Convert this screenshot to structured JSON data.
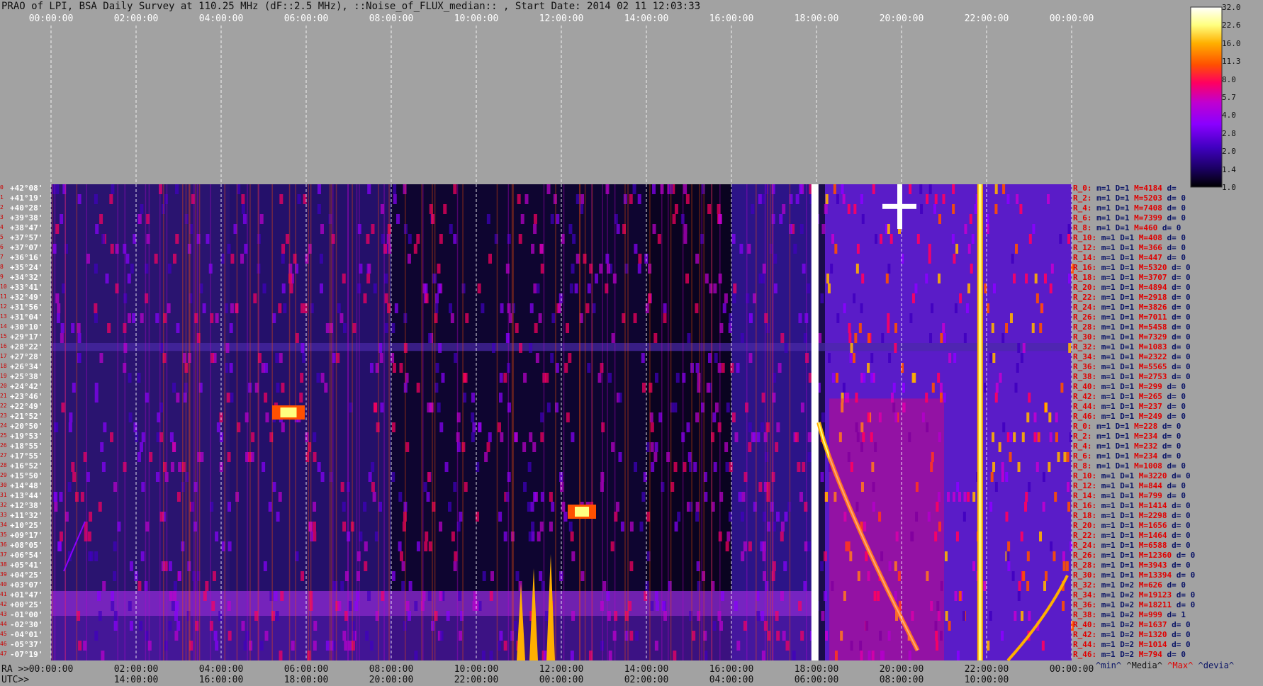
{
  "title": "PRAO of LPI, BSA Daily Survey at 110.25 MHz (dF::2.5 MHz), ::Noise_of_FLUX_median:: , Start Date: 2014 02 11 12:03:33",
  "chart_data": {
    "type": "heatmap",
    "title": "PRAO of LPI, BSA Daily Survey at 110.25 MHz (dF::2.5 MHz), ::Noise_of_FLUX_median:: , Start Date: 2014 02 11 12:03:33",
    "x_top_ticks": [
      "00:00:00",
      "02:00:00",
      "04:00:00",
      "06:00:00",
      "08:00:00",
      "10:00:00",
      "12:00:00",
      "14:00:00",
      "16:00:00",
      "18:00:00",
      "20:00:00",
      "22:00:00",
      "00:00:00"
    ],
    "x_bottom_ra_label": "RA >>",
    "x_bottom_ra_ticks": [
      "00:00:00",
      "02:00:00",
      "04:00:00",
      "06:00:00",
      "08:00:00",
      "10:00:00",
      "12:00:00",
      "14:00:00",
      "16:00:00",
      "18:00:00",
      "20:00:00",
      "22:00:00",
      "00:00:00"
    ],
    "x_bottom_utc_label": "UTC>>",
    "x_bottom_utc_ticks": [
      "14:00:00",
      "16:00:00",
      "18:00:00",
      "20:00:00",
      "22:00:00",
      "00:00:00",
      "02:00:00",
      "04:00:00",
      "06:00:00",
      "08:00:00",
      "10:00:00"
    ],
    "y_declination_labels": [
      "+42°08'",
      "+41°19'",
      "+40°28'",
      "+39°38'",
      "+38°47'",
      "+37°57'",
      "+37°07'",
      "+36°16'",
      "+35°24'",
      "+34°32'",
      "+33°41'",
      "+32°49'",
      "+31°56'",
      "+31°04'",
      "+30°10'",
      "+29°17'",
      "+28°22'",
      "+27°28'",
      "+26°34'",
      "+25°38'",
      "+24°42'",
      "+23°46'",
      "+22°49'",
      "+21°52'",
      "+20°50'",
      "+19°53'",
      "+18°55'",
      "+17°55'",
      "+16°52'",
      "+15°50'",
      "+14°48'",
      "+13°44'",
      "+12°38'",
      "+11°32'",
      "+10°25'",
      "+09°17'",
      "+08°05'",
      "+06°54'",
      "+05°41'",
      "+04°25'",
      "+03°07'",
      "+01°47'",
      "+00°25'",
      "-01°00'",
      "-02°30'",
      "-04°01'",
      "-05°37'",
      "-07°19'"
    ],
    "colorbar": {
      "ticks": [
        "32.0",
        "22.6",
        "16.0",
        "11.3",
        "8.0",
        "5.7",
        "4.0",
        "2.8",
        "2.0",
        "1.4",
        "1.0"
      ],
      "scale": "log",
      "range": [
        1.0,
        32.0
      ],
      "colormap": [
        "#000000",
        "#1a0060",
        "#4000c0",
        "#8a00ff",
        "#c000d0",
        "#ff0060",
        "#ff5000",
        "#ffb000",
        "#ffff80",
        "#ffffff"
      ]
    },
    "row_stats": [
      {
        "r": "R_0:",
        "m": "m=1",
        "d": "D=1",
        "max": "M=4184",
        "dev": "d="
      },
      {
        "r": "R_2:",
        "m": "m=1",
        "d": "D=1",
        "max": "M=5203",
        "dev": "d= 0"
      },
      {
        "r": "R_4:",
        "m": "m=1",
        "d": "D=1",
        "max": "M=7408",
        "dev": "d= 0"
      },
      {
        "r": "R_6:",
        "m": "m=1",
        "d": "D=1",
        "max": "M=7399",
        "dev": "d= 0"
      },
      {
        "r": "R_8:",
        "m": "m=1",
        "d": "D=1",
        "max": "M=460",
        "dev": "d= 0"
      },
      {
        "r": "R_10:",
        "m": "m=1",
        "d": "D=1",
        "max": "M=408",
        "dev": "d= 0"
      },
      {
        "r": "R_12:",
        "m": "m=1",
        "d": "D=1",
        "max": "M=366",
        "dev": "d= 0"
      },
      {
        "r": "R_14:",
        "m": "m=1",
        "d": "D=1",
        "max": "M=447",
        "dev": "d= 0"
      },
      {
        "r": "R_16:",
        "m": "m=1",
        "d": "D=1",
        "max": "M=5320",
        "dev": "d= 0"
      },
      {
        "r": "R_18:",
        "m": "m=1",
        "d": "D=1",
        "max": "M=3707",
        "dev": "d= 0"
      },
      {
        "r": "R_20:",
        "m": "m=1",
        "d": "D=1",
        "max": "M=4894",
        "dev": "d= 0"
      },
      {
        "r": "R_22:",
        "m": "m=1",
        "d": "D=1",
        "max": "M=2918",
        "dev": "d= 0"
      },
      {
        "r": "R_24:",
        "m": "m=1",
        "d": "D=1",
        "max": "M=3826",
        "dev": "d= 0"
      },
      {
        "r": "R_26:",
        "m": "m=1",
        "d": "D=1",
        "max": "M=7011",
        "dev": "d= 0"
      },
      {
        "r": "R_28:",
        "m": "m=1",
        "d": "D=1",
        "max": "M=5458",
        "dev": "d= 0"
      },
      {
        "r": "R_30:",
        "m": "m=1",
        "d": "D=1",
        "max": "M=7329",
        "dev": "d= 0"
      },
      {
        "r": "R_32:",
        "m": "m=1",
        "d": "D=1",
        "max": "M=1083",
        "dev": "d= 0"
      },
      {
        "r": "R_34:",
        "m": "m=1",
        "d": "D=1",
        "max": "M=2322",
        "dev": "d= 0"
      },
      {
        "r": "R_36:",
        "m": "m=1",
        "d": "D=1",
        "max": "M=5565",
        "dev": "d= 0"
      },
      {
        "r": "R_38:",
        "m": "m=1",
        "d": "D=1",
        "max": "M=2753",
        "dev": "d= 0"
      },
      {
        "r": "R_40:",
        "m": "m=1",
        "d": "D=1",
        "max": "M=299",
        "dev": "d= 0"
      },
      {
        "r": "R_42:",
        "m": "m=1",
        "d": "D=1",
        "max": "M=265",
        "dev": "d= 0"
      },
      {
        "r": "R_44:",
        "m": "m=1",
        "d": "D=1",
        "max": "M=237",
        "dev": "d= 0"
      },
      {
        "r": "R_46:",
        "m": "m=1",
        "d": "D=1",
        "max": "M=249",
        "dev": "d= 0"
      },
      {
        "r": "R_0:",
        "m": "m=1",
        "d": "D=1",
        "max": "M=228",
        "dev": "d= 0"
      },
      {
        "r": "R_2:",
        "m": "m=1",
        "d": "D=1",
        "max": "M=234",
        "dev": "d= 0"
      },
      {
        "r": "R_4:",
        "m": "m=1",
        "d": "D=1",
        "max": "M=232",
        "dev": "d= 0"
      },
      {
        "r": "R_6:",
        "m": "m=1",
        "d": "D=1",
        "max": "M=234",
        "dev": "d= 0"
      },
      {
        "r": "R_8:",
        "m": "m=1",
        "d": "D=1",
        "max": "M=1008",
        "dev": "d= 0"
      },
      {
        "r": "R_10:",
        "m": "m=1",
        "d": "D=1",
        "max": "M=3220",
        "dev": "d= 0"
      },
      {
        "r": "R_12:",
        "m": "m=1",
        "d": "D=1",
        "max": "M=844",
        "dev": "d= 0"
      },
      {
        "r": "R_14:",
        "m": "m=1",
        "d": "D=1",
        "max": "M=799",
        "dev": "d= 0"
      },
      {
        "r": "R_16:",
        "m": "m=1",
        "d": "D=1",
        "max": "M=1414",
        "dev": "d= 0"
      },
      {
        "r": "R_18:",
        "m": "m=1",
        "d": "D=1",
        "max": "M=2298",
        "dev": "d= 0"
      },
      {
        "r": "R_20:",
        "m": "m=1",
        "d": "D=1",
        "max": "M=1656",
        "dev": "d= 0"
      },
      {
        "r": "R_22:",
        "m": "m=1",
        "d": "D=1",
        "max": "M=1464",
        "dev": "d= 0"
      },
      {
        "r": "R_24:",
        "m": "m=1",
        "d": "D=1",
        "max": "M=6588",
        "dev": "d= 0"
      },
      {
        "r": "R_26:",
        "m": "m=1",
        "d": "D=1",
        "max": "M=12360",
        "dev": "d= 0"
      },
      {
        "r": "R_28:",
        "m": "m=1",
        "d": "D=1",
        "max": "M=3943",
        "dev": "d= 0"
      },
      {
        "r": "R_30:",
        "m": "m=1",
        "d": "D=1",
        "max": "M=13394",
        "dev": "d= 0"
      },
      {
        "r": "R_32:",
        "m": "m=1",
        "d": "D=2",
        "max": "M=626",
        "dev": "d= 0"
      },
      {
        "r": "R_34:",
        "m": "m=1",
        "d": "D=2",
        "max": "M=19123",
        "dev": "d= 0"
      },
      {
        "r": "R_36:",
        "m": "m=1",
        "d": "D=2",
        "max": "M=18211",
        "dev": "d= 0"
      },
      {
        "r": "R_38:",
        "m": "m=1",
        "d": "D=2",
        "max": "M=999",
        "dev": "d= 1"
      },
      {
        "r": "R_40:",
        "m": "m=1",
        "d": "D=2",
        "max": "M=1637",
        "dev": "d= 0"
      },
      {
        "r": "R_42:",
        "m": "m=1",
        "d": "D=2",
        "max": "M=1320",
        "dev": "d= 0"
      },
      {
        "r": "R_44:",
        "m": "m=1",
        "d": "D=2",
        "max": "M=1014",
        "dev": "d= 0"
      },
      {
        "r": "R_46:",
        "m": "m=1",
        "d": "D=2",
        "max": "M=794",
        "dev": "d= 0"
      }
    ],
    "stat_legend": {
      "min": "^min^",
      "media": "^Media^",
      "max": "^Max^",
      "devia": "^devia^"
    },
    "features": [
      {
        "name": "bright transit track (sun)",
        "ra_start": "18:00:00",
        "ra_end": "20:30:00",
        "dec_start": "+20°50'",
        "dec_end": "-07°19'"
      },
      {
        "name": "bright vertical source column",
        "ra": "21:50:00"
      },
      {
        "name": "bright blob",
        "ra": "05:45:00",
        "dec": "+22°49'"
      },
      {
        "name": "bright blob",
        "ra": "12:30:00",
        "dec": "+12°38'"
      },
      {
        "name": "bright cross",
        "ra": "19:55:00",
        "dec": "+40°28'"
      }
    ]
  }
}
